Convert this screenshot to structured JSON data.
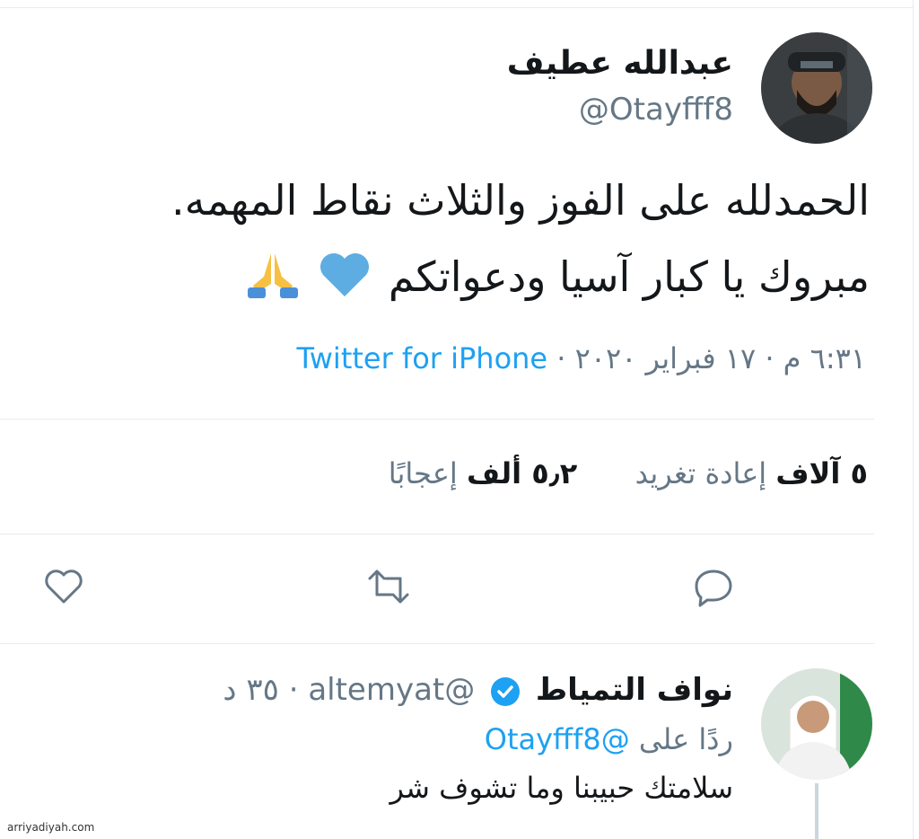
{
  "tweet": {
    "author_name": "عبدالله عطيف",
    "author_handle": "@Otayfff8",
    "text_line1": "الحمدلله على الفوز والثلاث نقاط المهمه.",
    "text_line2": "مبروك يا كبار آسيا ودعواتكم",
    "emojis": [
      "blue-heart-icon",
      "folded-hands-icon"
    ],
    "time": "٦:٣١ م",
    "date": "١٧ فبراير ٢٠٢٠",
    "source": "Twitter for iPhone",
    "dot": "·"
  },
  "stats": {
    "retweets_value": "٥ آلاف",
    "retweets_label": "إعادة تغريد",
    "likes_value": "٥٫٢ ألف",
    "likes_label": "إعجابًا"
  },
  "reply": {
    "author_name": "نواف التمياط",
    "author_handle": "@altemyat",
    "time": "٣٥ د",
    "dot": "·",
    "replying_prefix": "ردًا على",
    "replying_handle": "@Otayfff8",
    "text": "سلامتك حبيبنا وما تشوف شر"
  },
  "watermark": "arriyadiyah.com",
  "colors": {
    "link_blue": "#1da1f2",
    "muted_gray": "#657786",
    "text_dark": "#14171a",
    "divider": "#e6ecf0"
  }
}
